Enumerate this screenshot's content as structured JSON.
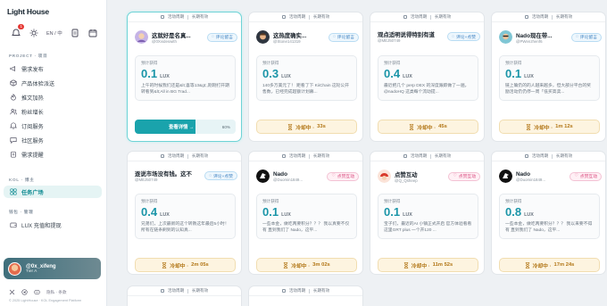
{
  "app": {
    "title": "Light House",
    "copyright": "© 2025 LightHouse · KOL Engagement Platform"
  },
  "topbar": {
    "notif_count": "1",
    "lang": "EN / 中"
  },
  "sidebar": {
    "sections": [
      {
        "label": "PROJECT · 项目"
      },
      {
        "label": "KOL · 博主"
      },
      {
        "label": "钱包 · 管理"
      }
    ],
    "items": [
      {
        "label": "需求发布"
      },
      {
        "label": "产品体验派送"
      },
      {
        "label": "推文加热"
      },
      {
        "label": "粉丝增长"
      },
      {
        "label": "订阅服务"
      },
      {
        "label": "社区服务"
      },
      {
        "label": "需求提醒"
      },
      {
        "label": "任务广场"
      },
      {
        "label": "LUX 充值和提现"
      }
    ]
  },
  "user": {
    "name": "@0x_xifeng",
    "tier": "Tier A"
  },
  "footer": {
    "social_text": "隐私 · 条款"
  },
  "common": {
    "tag1": "活动周期",
    "tag2": "长期有效",
    "earn_label": "预计获得",
    "unit": "LUX",
    "cool_prefix": "冷却中 ·",
    "view_label": "查看详情 →"
  },
  "cards": [
    {
      "title": "这就好是名真...",
      "handle": "@0Xvideswith",
      "btn": "评论留言",
      "amount": "0.1",
      "desc": "上午的时候我们还是&lt;喜等13&gt;,刚刚打开期转看到&lt;All in BG Trad...",
      "progress_pct": "60%",
      "progress": 0.6,
      "selected": true
    },
    {
      "title": "这热度确实...",
      "handle": "@Stone141319",
      "btn": "评论留言",
      "amount": "0.3",
      "desc": "140多万美元了！ 距看了下 KiiChain 这轮公开售数，已经完成超额计划募...",
      "cool": "33s"
    },
    {
      "title": "观点适明说得特别有道",
      "handle": "@MEJ50749",
      "btn": "评论+点赞",
      "amount": "0.4",
      "desc": "最近把几个 perp DEX 的深度跟踪做了一遍，@nadoHQ 这类每个流动提...",
      "cool": "45s"
    },
    {
      "title": "Nado现在带...",
      "handle": "@PWenzhenf6",
      "btn": "评论留言",
      "amount": "0.1",
      "desc": "链上确仍的的人越来越多，但大部分平台的奖励活动仍仍停一周「低买高卖...",
      "cool": "1m 12s"
    },
    {
      "title": "逐说市场没有钱。这不",
      "handle": "@MEJ50749",
      "btn": "评论+点赞",
      "amount": "0.4",
      "desc": "兄弟们，上次最新的这个转教这年最后5小时！ 所有在链条刷到的认知真...",
      "cool": "2m 05s"
    },
    {
      "title": "Nado",
      "handle": "@Duomin1849...",
      "btn": "点赞互动",
      "amount": "0.1",
      "desc": "一些本金，做吃两要积分？？？ 我以真要不仅有 直到我们了 Nado，这平...",
      "cool": "3m 02s",
      "pink": true
    },
    {
      "title": "点赞互动",
      "handle": "@Q_Qsheep",
      "btn": "点赞互动",
      "amount": "0.1",
      "desc": "宝子们，最近的AI 小镇正式开启 官方体验看看这里GRT plus 一个开120 ...",
      "cool": "11m 52s",
      "pink": true
    },
    {
      "title": "Nado",
      "handle": "@Duomin1849...",
      "btn": "点赞互动",
      "amount": "0.8",
      "desc": "一些本金，做吃两要积分？？？ 我以来要不得有 直到我们了 Nado，这平...",
      "cool": "17m 24s",
      "pink": true
    }
  ],
  "colors": {
    "accent": "#1aa3ac",
    "cool": "#b27616",
    "active_bg": "#e5f4f4"
  }
}
